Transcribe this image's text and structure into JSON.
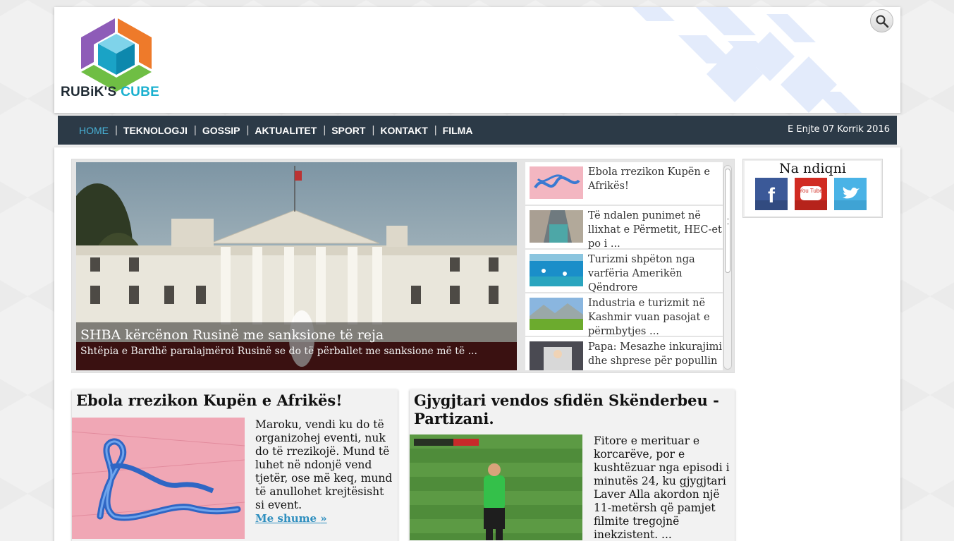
{
  "header": {
    "logo_word1": "RUBiK'S",
    "logo_word2": "CUBE"
  },
  "nav": {
    "items": [
      {
        "label": "HOME",
        "active": true
      },
      {
        "label": "TEKNOLOGJI"
      },
      {
        "label": "GOSSIP"
      },
      {
        "label": "AKTUALITET"
      },
      {
        "label": "SPORT"
      },
      {
        "label": "KONTAKT"
      },
      {
        "label": "FILMA"
      }
    ],
    "separator": "|",
    "date": "E Enjte 07 Korrik 2016"
  },
  "slider": {
    "main": {
      "title": "SHBA kërcënon Rusinë me sanksione të reja",
      "description": "Shtëpia e Bardhë paralajmëroi Rusinë se do të përballet me sanksione më të ..."
    },
    "thumbs": [
      {
        "title": "Ebola rrezikon Kupën e Afrikës!"
      },
      {
        "title": "Të ndalen punimet në llixhat e Përmetit, HEC-et po i ..."
      },
      {
        "title": "Turizmi shpëton nga varfëria Amerikën Qëndrore"
      },
      {
        "title": "Industria e turizmit në Kashmir vuan pasojat e përmbytjes ..."
      },
      {
        "title": "Papa: Mesazhe inkurajimi dhe shprese për popullin ..."
      }
    ]
  },
  "sidebar": {
    "follow_title": "Na ndiqni",
    "youtube_label": "You Tube",
    "colors": {
      "facebook": "#3b5998",
      "youtube": "#d12b22",
      "twitter": "#4ab3e6"
    }
  },
  "articles": [
    {
      "title": "Ebola rrezikon Kupën e Afrikës!",
      "excerpt": "Maroku, vendi ku do të organizohej eventi, nuk do të rrezikojë. Mund të luhet në ndonjë vend tjetër, ose më keq, mund të anullohet krejtësisht si event.",
      "more": "Me shume"
    },
    {
      "title": "Gjygjtari vendos sfidën Skënderbeu -Partizani.",
      "excerpt": "Fitore e merituar e korcarëve, por e kushtëzuar nga episodi i minutës 24, ku gjygjtari Laver Alla akordon një 11-metërsh që pamjet filmite tregojnë inekzistent. ..."
    }
  ],
  "colors": {
    "nav_bg": "#2c3a47",
    "nav_active": "#48b3d8",
    "link": "#2f8fbf"
  }
}
